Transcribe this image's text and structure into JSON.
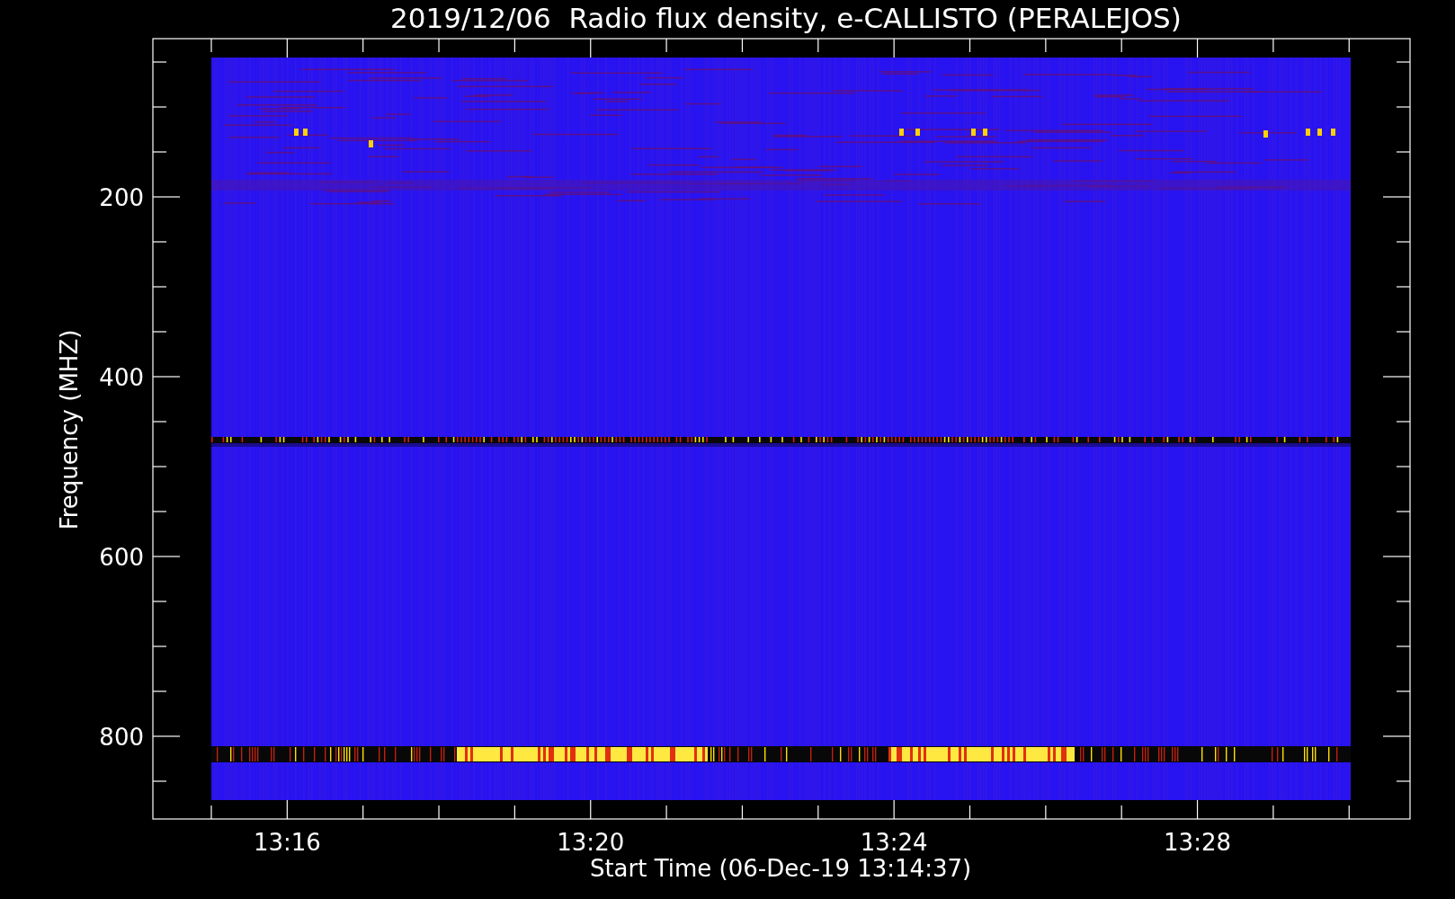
{
  "title": "2019/12/06  Radio flux density, e-CALLISTO (PERALEJOS)",
  "y_axis": {
    "label": "Frequency (MHZ)",
    "ticks": [
      "200",
      "400",
      "600",
      "800"
    ]
  },
  "x_axis": {
    "label": "Start Time (06-Dec-19 13:14:37)",
    "ticks": [
      "13:16",
      "13:20",
      "13:24",
      "13:28"
    ]
  }
}
